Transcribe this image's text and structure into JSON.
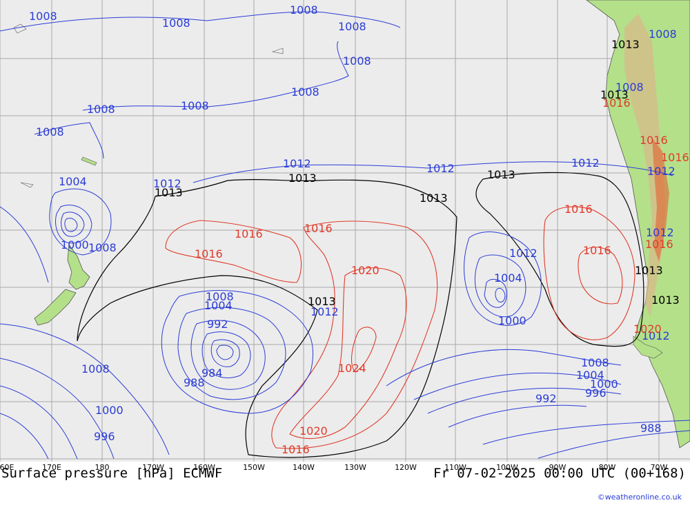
{
  "title": "Surface pressure [hPa] ECMWF",
  "valid_time": "Fr 07-02-2025 00:00 UTC (00+168)",
  "credit": "©weatheronline.co.uk",
  "colors": {
    "land": "#b4e08a",
    "highland": "#d8b88a",
    "sea": "#ececec",
    "grid": "#a8a8a8",
    "isobar_low": "#2a3cd6",
    "isobar_high": "#e03a2a",
    "isobar_1013": "#000000"
  },
  "longitude_ticks": [
    "60E",
    "170E",
    "180",
    "170W",
    "160W",
    "150W",
    "140W",
    "130W",
    "120W",
    "110W",
    "100W",
    "90W",
    "80W",
    "70W"
  ],
  "isobar_labels": [
    {
      "text": "1008",
      "color": "blue"
    },
    {
      "text": "1008",
      "color": "blue"
    },
    {
      "text": "1008",
      "color": "blue"
    },
    {
      "text": "1008",
      "color": "blue"
    },
    {
      "text": "1008",
      "color": "blue"
    },
    {
      "text": "1008",
      "color": "blue"
    },
    {
      "text": "1008",
      "color": "blue"
    },
    {
      "text": "1008",
      "color": "blue"
    },
    {
      "text": "1008",
      "color": "blue"
    },
    {
      "text": "1012",
      "color": "blue"
    },
    {
      "text": "1012",
      "color": "blue"
    },
    {
      "text": "1012",
      "color": "blue"
    },
    {
      "text": "1012",
      "color": "blue"
    },
    {
      "text": "1004",
      "color": "blue"
    },
    {
      "text": "1000",
      "color": "blue"
    },
    {
      "text": "1008",
      "color": "blue"
    },
    {
      "text": "1008",
      "color": "blue"
    },
    {
      "text": "1004",
      "color": "blue"
    },
    {
      "text": "992",
      "color": "blue"
    },
    {
      "text": "984",
      "color": "blue"
    },
    {
      "text": "988",
      "color": "blue"
    },
    {
      "text": "1008",
      "color": "blue"
    },
    {
      "text": "1000",
      "color": "blue"
    },
    {
      "text": "996",
      "color": "blue"
    },
    {
      "text": "1012",
      "color": "blue"
    },
    {
      "text": "1004",
      "color": "blue"
    },
    {
      "text": "1008",
      "color": "blue"
    },
    {
      "text": "1012",
      "color": "blue"
    },
    {
      "text": "1000",
      "color": "blue"
    },
    {
      "text": "1008",
      "color": "blue"
    },
    {
      "text": "1004",
      "color": "blue"
    },
    {
      "text": "1000",
      "color": "blue"
    },
    {
      "text": "996",
      "color": "blue"
    },
    {
      "text": "992",
      "color": "blue"
    },
    {
      "text": "988",
      "color": "blue"
    },
    {
      "text": "1012",
      "color": "blue"
    },
    {
      "text": "1008",
      "color": "blue"
    },
    {
      "text": "1012",
      "color": "blue"
    },
    {
      "text": "1012",
      "color": "blue"
    },
    {
      "text": "1013",
      "color": "black"
    },
    {
      "text": "1013",
      "color": "black"
    },
    {
      "text": "1013",
      "color": "black"
    },
    {
      "text": "1013",
      "color": "black"
    },
    {
      "text": "1013",
      "color": "black"
    },
    {
      "text": "1013",
      "color": "black"
    },
    {
      "text": "1013",
      "color": "black"
    },
    {
      "text": "1013",
      "color": "black"
    },
    {
      "text": "1013",
      "color": "black"
    },
    {
      "text": "1016",
      "color": "red"
    },
    {
      "text": "1016",
      "color": "red"
    },
    {
      "text": "1016",
      "color": "red"
    },
    {
      "text": "1016",
      "color": "red"
    },
    {
      "text": "1020",
      "color": "red"
    },
    {
      "text": "1024",
      "color": "red"
    },
    {
      "text": "1020",
      "color": "red"
    },
    {
      "text": "1016",
      "color": "red"
    },
    {
      "text": "1016",
      "color": "red"
    },
    {
      "text": "1020",
      "color": "red"
    },
    {
      "text": "1016",
      "color": "red"
    },
    {
      "text": "1016",
      "color": "red"
    },
    {
      "text": "1016",
      "color": "red"
    },
    {
      "text": "1016",
      "color": "red"
    }
  ]
}
